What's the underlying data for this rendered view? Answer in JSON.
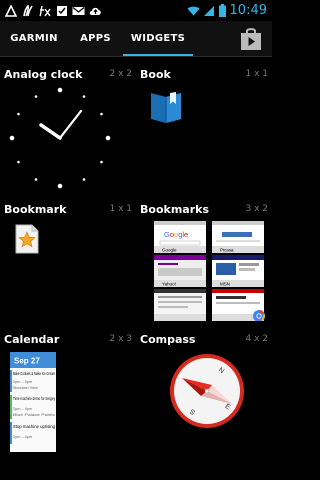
{
  "status_bar": {
    "time": "10:49",
    "left_icons": [
      "garmin-icon",
      "nexus-icon",
      "fx-icon",
      "checklist-icon",
      "gmail-icon",
      "upload-cloud-icon"
    ],
    "right_icons": [
      "wifi-icon",
      "signal-icon",
      "battery-icon"
    ]
  },
  "tabs": [
    {
      "label": "GARMIN",
      "selected": false
    },
    {
      "label": "APPS",
      "selected": false
    },
    {
      "label": "WIDGETS",
      "selected": true
    }
  ],
  "colors": {
    "accent": "#33b5e5",
    "background": "#000000",
    "tab_bar": "#111111"
  },
  "widgets": [
    {
      "title": "Analog clock",
      "size": "2 x 2"
    },
    {
      "title": "Book",
      "size": "1 x 1"
    },
    {
      "title": "Bookmark",
      "size": "1 x 1"
    },
    {
      "title": "Bookmarks",
      "size": "3 x 2"
    },
    {
      "title": "Calendar",
      "size": "2 x 3"
    },
    {
      "title": "Compass",
      "size": "4 x 2"
    }
  ],
  "bookmarks_preview": {
    "tiles": [
      {
        "label": "Google"
      },
      {
        "label": "Picasa"
      },
      {
        "label": "Yahoo!"
      },
      {
        "label": "MSN"
      },
      {
        "label": ""
      },
      {
        "label": ""
      }
    ]
  },
  "calendar_preview": {
    "date": "Sep 27",
    "events": [
      {
        "title": "Bake Cookies & Make Ice Cream",
        "time": "2pm – 4pm",
        "place": "Mountain View"
      },
      {
        "title": "Time machine demo for Sergey",
        "time": "2pm – 4pm",
        "place": "Blue Palace Public"
      },
      {
        "title": "Stop machine uprising",
        "time": "2pm – 4pm",
        "place": ""
      }
    ]
  },
  "compass_preview": {
    "letters": [
      "N",
      "E",
      "S"
    ]
  }
}
